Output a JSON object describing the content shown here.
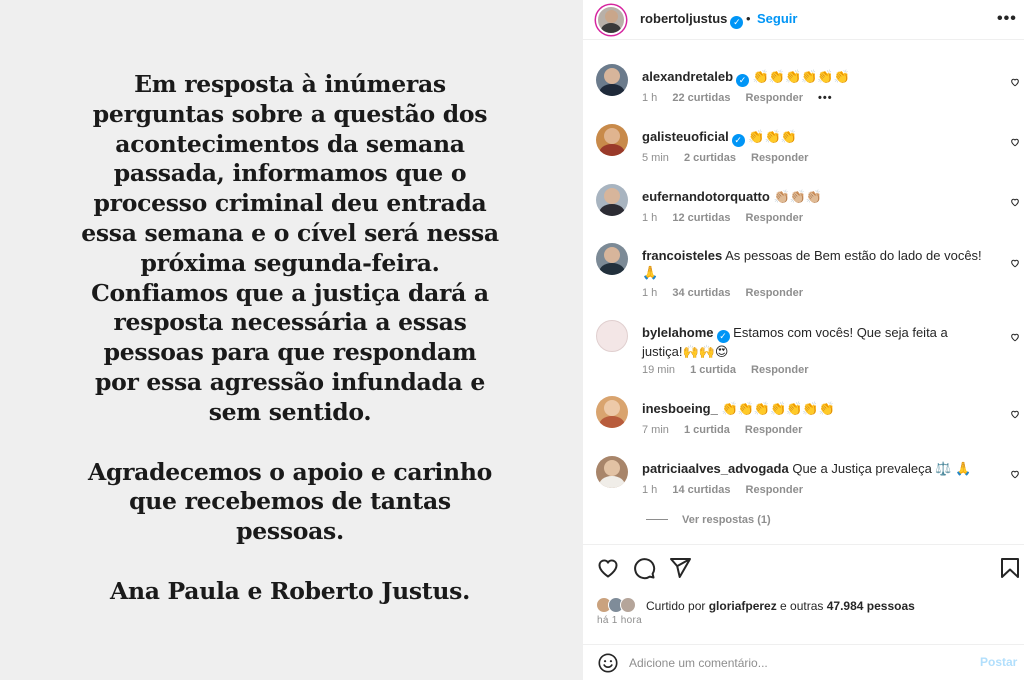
{
  "post": {
    "text_paragraphs": [
      [
        "Em resposta à inúmeras",
        "perguntas sobre a questão dos",
        "acontecimentos da semana",
        "passada, informamos que o",
        "processo criminal deu entrada",
        "essa semana e o cível será nessa",
        "próxima segunda-feira.",
        "Confiamos que a justiça dará a",
        "resposta necessária a essas",
        "pessoas para que respondam",
        "por essa agressão infundada e",
        "sem sentido."
      ],
      [
        "Agradecemos  o apoio e carinho",
        "que recebemos  de tantas",
        "pessoas."
      ],
      [
        "Ana Paula e Roberto Justus."
      ]
    ]
  },
  "header": {
    "username": "robertoljustus",
    "verified_mark": "✓",
    "separator": "•",
    "follow_label": "Seguir",
    "more_label": "•••"
  },
  "comments": [
    {
      "username": "alexandretaleb",
      "verified": true,
      "text": "👏👏👏👏👏👏",
      "time": "1 h",
      "likes": "22 curtidas",
      "reply": "Responder",
      "more": "•••"
    },
    {
      "username": "galisteuoficial",
      "verified": true,
      "text": "👏👏👏",
      "time": "5 min",
      "likes": "2 curtidas",
      "reply": "Responder"
    },
    {
      "username": "eufernandotorquatto",
      "verified": false,
      "text": "👏🏼👏🏼👏🏼",
      "time": "1 h",
      "likes": "12 curtidas",
      "reply": "Responder"
    },
    {
      "username": "francoisteles",
      "verified": false,
      "text": "As pessoas de Bem estão do lado de vocês! 🙏",
      "time": "1 h",
      "likes": "34 curtidas",
      "reply": "Responder"
    },
    {
      "username": "bylelahome",
      "verified": true,
      "text": "Estamos com vocês! Que seja feita a justiça!🙌🙌😍",
      "time": "19 min",
      "likes": "1 curtida",
      "reply": "Responder"
    },
    {
      "username": "inesboeing_",
      "verified": false,
      "text": "👏👏👏👏👏👏👏",
      "time": "7 min",
      "likes": "1 curtida",
      "reply": "Responder"
    },
    {
      "username": "patriciaalves_advogada",
      "verified": false,
      "text": "Que a Justiça prevaleça ⚖️ 🙏",
      "time": "1 h",
      "likes": "14 curtidas",
      "reply": "Responder"
    }
  ],
  "view_replies": "Ver respostas (1)",
  "likes": {
    "prefix": "Curtido por ",
    "user": "gloriafperez",
    "middle": " e outras ",
    "count": "47.984 pessoas"
  },
  "time_ago": "há 1 hora",
  "add_comment": {
    "placeholder": "Adicione um comentário...",
    "post_label": "Postar"
  },
  "icons": {
    "like": "heart-icon",
    "comment": "comment-icon",
    "share": "share-icon",
    "save": "bookmark-icon",
    "emoji": "emoji-icon"
  }
}
